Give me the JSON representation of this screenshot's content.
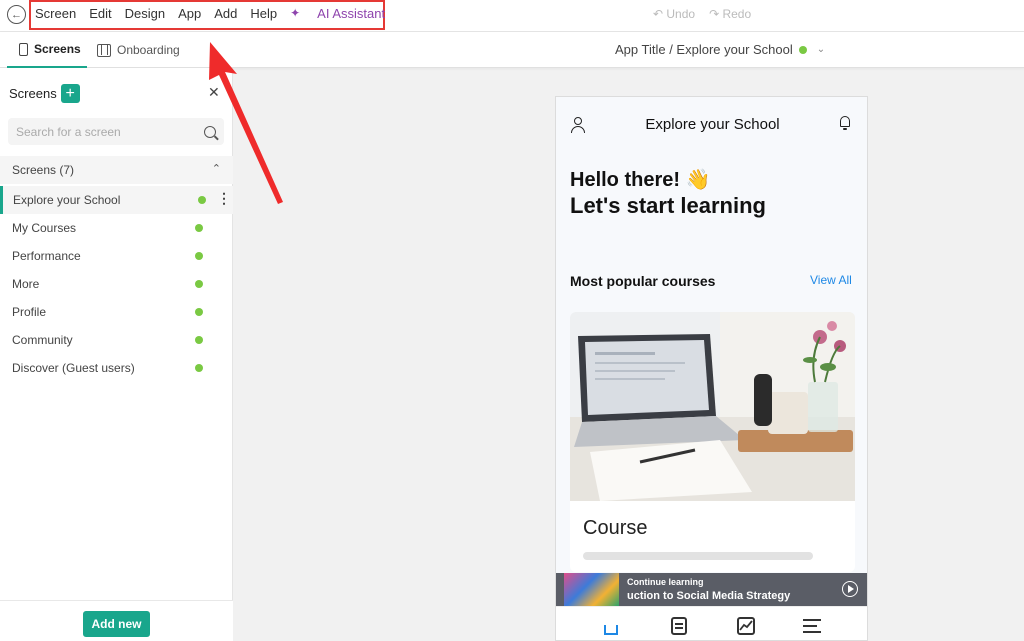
{
  "menubar": {
    "items": [
      "Screen",
      "Edit",
      "Design",
      "App",
      "Add",
      "Help"
    ],
    "ai_label": "AI Assistant",
    "undo": "↶ Undo",
    "redo": "↷ Redo"
  },
  "tabbar": {
    "tabs": [
      {
        "label": "Screens",
        "icon": "phone-icon"
      },
      {
        "label": "Onboarding",
        "icon": "onboarding-icon"
      }
    ],
    "app_title": "App Title / Explore your School"
  },
  "sidebar": {
    "title": "Screens",
    "search_placeholder": "Search for a screen",
    "group_label": "Screens (7)",
    "items": [
      {
        "label": "Explore your School",
        "active": true
      },
      {
        "label": "My Courses"
      },
      {
        "label": "Performance"
      },
      {
        "label": "More"
      },
      {
        "label": "Profile"
      },
      {
        "label": "Community"
      },
      {
        "label": "Discover (Guest users)"
      }
    ],
    "add_new": "Add new"
  },
  "phone": {
    "title": "Explore your School",
    "hello": "Hello there! 👋",
    "start": "Let's start learning",
    "popular": "Most popular courses",
    "view_all": "View All",
    "course": "Course",
    "player_label": "Continue learning",
    "player_track": "uction to Social Media Strategy"
  },
  "colors": {
    "accent": "#19a68c",
    "status_green": "#7ac943",
    "highlight_red": "#e53935",
    "ai_purple": "#8e44ad",
    "link_blue": "#1e88e5"
  }
}
